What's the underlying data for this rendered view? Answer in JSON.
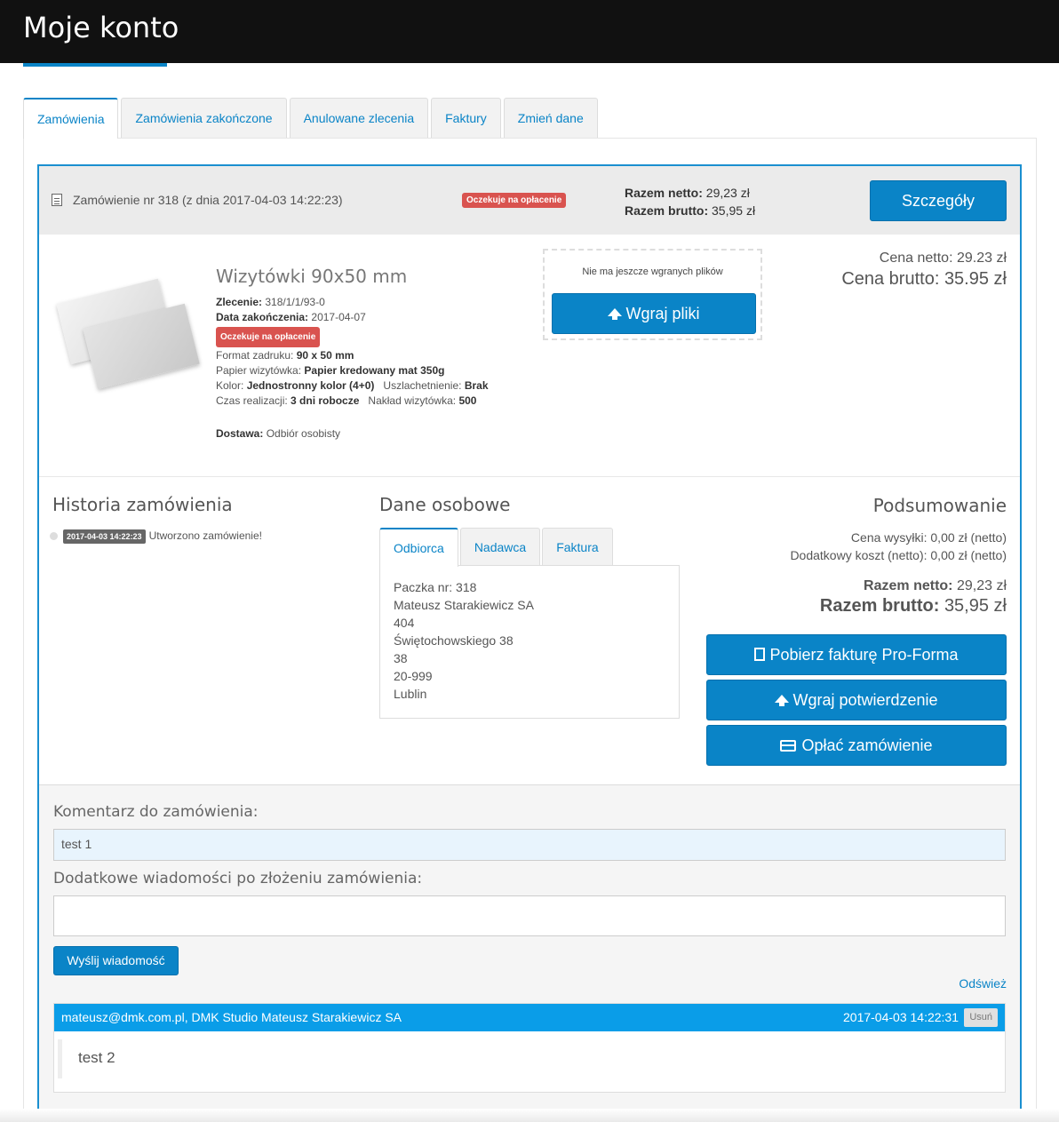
{
  "header": {
    "title": "Moje konto"
  },
  "tabs": [
    {
      "label": "Zamówienia"
    },
    {
      "label": "Zamówienia zakończone"
    },
    {
      "label": "Anulowane zlecenia"
    },
    {
      "label": "Faktury"
    },
    {
      "label": "Zmień dane"
    }
  ],
  "order": {
    "title": "Zamówienie nr 318 (z dnia 2017-04-03 14:22:23)",
    "status": "Oczekuje na opłacenie",
    "net_label": "Razem netto:",
    "net_value": "29,23 zł",
    "gross_label": "Razem brutto:",
    "gross_value": "35,95 zł",
    "details_button": "Szczegóły"
  },
  "product": {
    "name": "Wizytówki 90x50 mm",
    "zlecenie_label": "Zlecenie:",
    "zlecenie_value": "318/1/1/93-0",
    "data_label": "Data zakończenia:",
    "data_value": "2017-04-07",
    "status": "Oczekuje na opłacenie",
    "format_label": "Format zadruku:",
    "format_value": "90 x 50 mm",
    "papier_label": "Papier wizytówka:",
    "papier_value": "Papier kredowany mat 350g",
    "kolor_label": "Kolor:",
    "kolor_value": "Jednostronny kolor (4+0)",
    "uszl_label": "Uszlachetnienie:",
    "uszl_value": "Brak",
    "czas_label": "Czas realizacji:",
    "czas_value": "3 dni robocze",
    "naklad_label": "Nakład wizytówka:",
    "naklad_value": "500",
    "dostawa_label": "Dostawa:",
    "dostawa_value": "Odbiór osobisty",
    "cena_netto": "Cena netto: 29.23 zł",
    "cena_brutto": "Cena brutto: 35.95 zł"
  },
  "upload": {
    "note": "Nie ma jeszcze wgranych plików",
    "button": "Wgraj pliki"
  },
  "history": {
    "title": "Historia zamówienia",
    "entries": [
      {
        "date": "2017-04-03 14:22:23",
        "text": "Utworzono zamówienie!"
      }
    ]
  },
  "personal": {
    "title": "Dane osobowe",
    "tabs": [
      {
        "label": "Odbiorca"
      },
      {
        "label": "Nadawca"
      },
      {
        "label": "Faktura"
      }
    ],
    "address": [
      "Paczka nr: 318",
      "Mateusz Starakiewicz SA",
      "404",
      "Świętochowskiego 38",
      "38",
      "20-999",
      "Lublin"
    ]
  },
  "summary": {
    "title": "Podsumowanie",
    "shipping": "Cena wysyłki: 0,00 zł (netto)",
    "extra": "Dodatkowy koszt (netto): 0,00 zł (netto)",
    "net_label": "Razem netto:",
    "net_value": "29,23 zł",
    "gross_label": "Razem brutto:",
    "gross_value": "35,95 zł",
    "btn_invoice": "Pobierz fakturę Pro-Forma",
    "btn_confirm": "Wgraj potwierdzenie",
    "btn_pay": "Opłać zamówienie"
  },
  "comments": {
    "comment_label": "Komentarz do zamówienia:",
    "comment_value": "test 1",
    "extra_label": "Dodatkowe wiadomości po złożeniu zamówienia:",
    "send_button": "Wyślij wiadomość",
    "refresh": "Odśwież",
    "message": {
      "author": "mateusz@dmk.com.pl, DMK Studio Mateusz Starakiewicz SA",
      "date": "2017-04-03 14:22:31",
      "delete": "Usuń",
      "body": "test 2"
    }
  },
  "colors": {
    "accent": "#0a84c7",
    "danger": "#d9534f",
    "topbar": "#111111"
  }
}
